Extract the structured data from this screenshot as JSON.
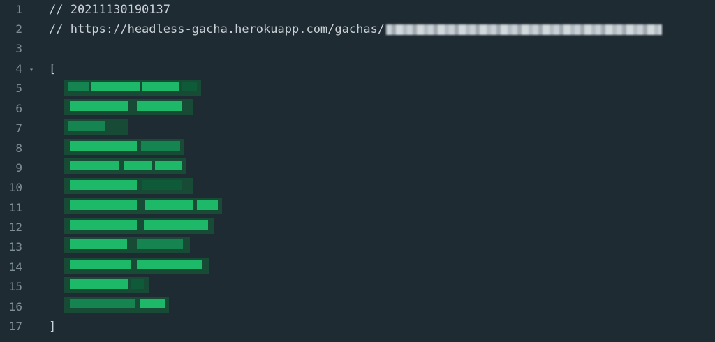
{
  "editor": {
    "line_numbers": [
      "1",
      "2",
      "3",
      "4",
      "5",
      "6",
      "7",
      "8",
      "9",
      "10",
      "11",
      "12",
      "13",
      "14",
      "15",
      "16",
      "17"
    ],
    "line1": "// 20211130190137",
    "line2": "// https://headless-gacha.herokuapp.com/gachas/",
    "line4": "[",
    "line17": "]",
    "fold_icon": "caret-down-icon",
    "blur_color": "#1fc26d"
  }
}
